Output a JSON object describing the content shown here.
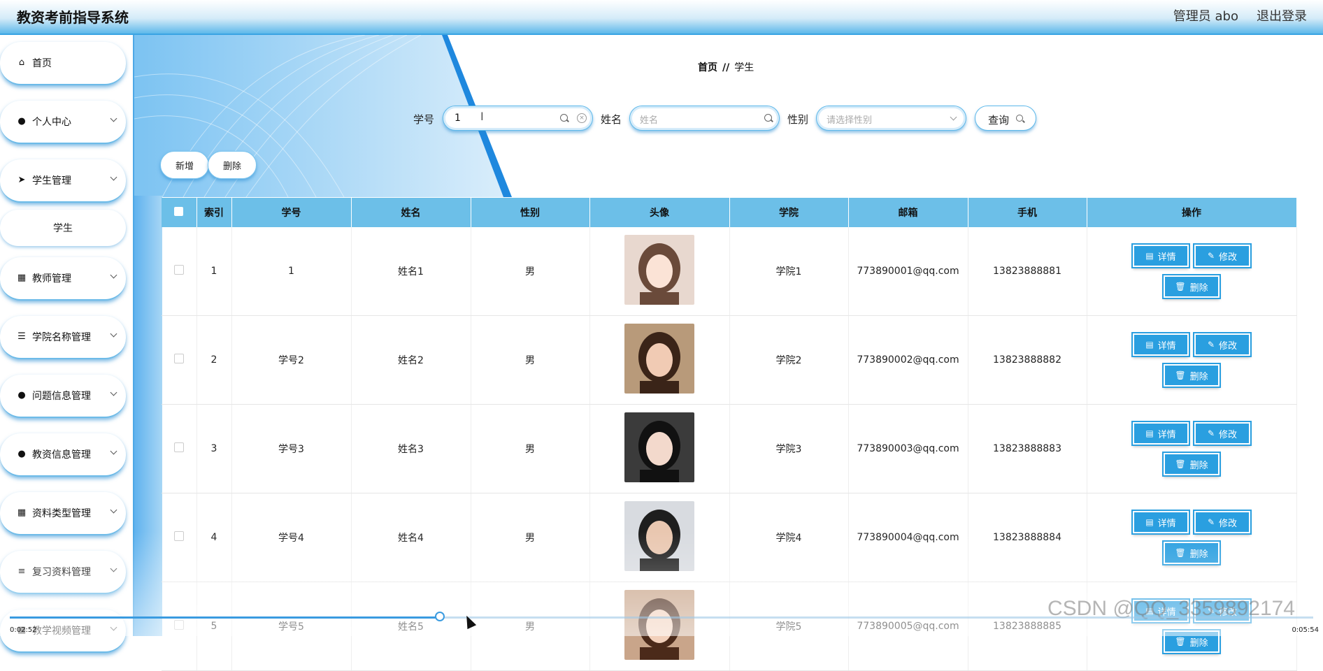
{
  "header": {
    "title": "教资考前指导系统",
    "user": "管理员 abo",
    "logout": "退出登录"
  },
  "sidebar": {
    "items": [
      {
        "label": "首页",
        "icon": "home-icon"
      },
      {
        "label": "个人中心",
        "icon": "user-icon"
      },
      {
        "label": "学生管理",
        "icon": "send-icon"
      },
      {
        "label": "教师管理",
        "icon": "grid-icon"
      },
      {
        "label": "学院名称管理",
        "icon": "sliders-icon"
      },
      {
        "label": "问题信息管理",
        "icon": "user-icon"
      },
      {
        "label": "教资信息管理",
        "icon": "user-icon"
      },
      {
        "label": "资料类型管理",
        "icon": "grid-icon"
      },
      {
        "label": "复习资料管理",
        "icon": "list-icon"
      },
      {
        "label": "教学视频管理",
        "icon": "grid-icon"
      }
    ],
    "sub_item": "学生"
  },
  "breadcrumb": {
    "home": "首页",
    "sep": "//",
    "current": "学生"
  },
  "search": {
    "id_label": "学号",
    "id_value": "1",
    "name_label": "姓名",
    "name_placeholder": "姓名",
    "gender_label": "性别",
    "gender_placeholder": "请选择性别",
    "query_label": "查询"
  },
  "actions": {
    "add": "新增",
    "delete": "删除"
  },
  "table": {
    "headers": [
      "索引",
      "学号",
      "姓名",
      "性别",
      "头像",
      "学院",
      "邮箱",
      "手机",
      "操作"
    ],
    "rows": [
      {
        "index": "1",
        "id": "1",
        "name": "姓名1",
        "gender": "男",
        "college": "学院1",
        "email": "773890001@qq.com",
        "phone": "13823888881"
      },
      {
        "index": "2",
        "id": "学号2",
        "name": "姓名2",
        "gender": "男",
        "college": "学院2",
        "email": "773890002@qq.com",
        "phone": "13823888882"
      },
      {
        "index": "3",
        "id": "学号3",
        "name": "姓名3",
        "gender": "男",
        "college": "学院3",
        "email": "773890003@qq.com",
        "phone": "13823888883"
      },
      {
        "index": "4",
        "id": "学号4",
        "name": "姓名4",
        "gender": "男",
        "college": "学院4",
        "email": "773890004@qq.com",
        "phone": "13823888884"
      },
      {
        "index": "5",
        "id": "学号5",
        "name": "姓名5",
        "gender": "男",
        "college": "学院5",
        "email": "773890005@qq.com",
        "phone": "13823888885"
      }
    ],
    "ops": {
      "detail": "详情",
      "edit": "修改",
      "delete": "删除"
    }
  },
  "player": {
    "current_time": "0:02:52",
    "total_time": "0:05:54",
    "progress": 0.33
  },
  "watermark": "CSDN @QQ_3359892174",
  "colors": {
    "accent": "#2a9fe0",
    "header_bg": "#6cbfe8",
    "border": "#5db8ea"
  }
}
